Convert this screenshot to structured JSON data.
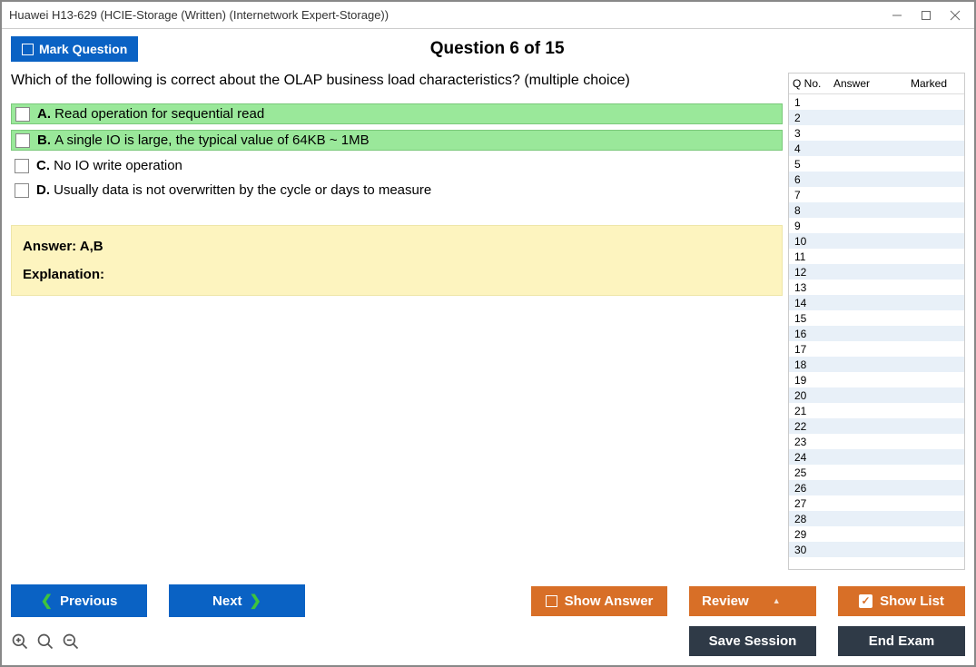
{
  "window": {
    "title": "Huawei H13-629 (HCIE-Storage (Written) (Internetwork Expert-Storage))"
  },
  "header": {
    "mark_label": "Mark Question",
    "question_counter": "Question 6 of 15"
  },
  "question": {
    "text": "Which of the following is correct about the OLAP business load characteristics? (multiple choice)",
    "options": [
      {
        "letter": "A.",
        "text": "Read operation for sequential read",
        "correct": true
      },
      {
        "letter": "B.",
        "text": "A single IO is large, the typical value of 64KB ~ 1MB",
        "correct": true
      },
      {
        "letter": "C.",
        "text": "No IO write operation",
        "correct": false
      },
      {
        "letter": "D.",
        "text": "Usually data is not overwritten by the cycle or days to measure",
        "correct": false
      }
    ]
  },
  "answer_panel": {
    "answer_label": "Answer: A,B",
    "explanation_label": "Explanation:"
  },
  "sidebar": {
    "col_qno": "Q No.",
    "col_answer": "Answer",
    "col_marked": "Marked",
    "row_count": 30
  },
  "buttons": {
    "previous": "Previous",
    "next": "Next",
    "show_answer": "Show Answer",
    "review": "Review",
    "show_list": "Show List",
    "save_session": "Save Session",
    "end_exam": "End Exam"
  }
}
